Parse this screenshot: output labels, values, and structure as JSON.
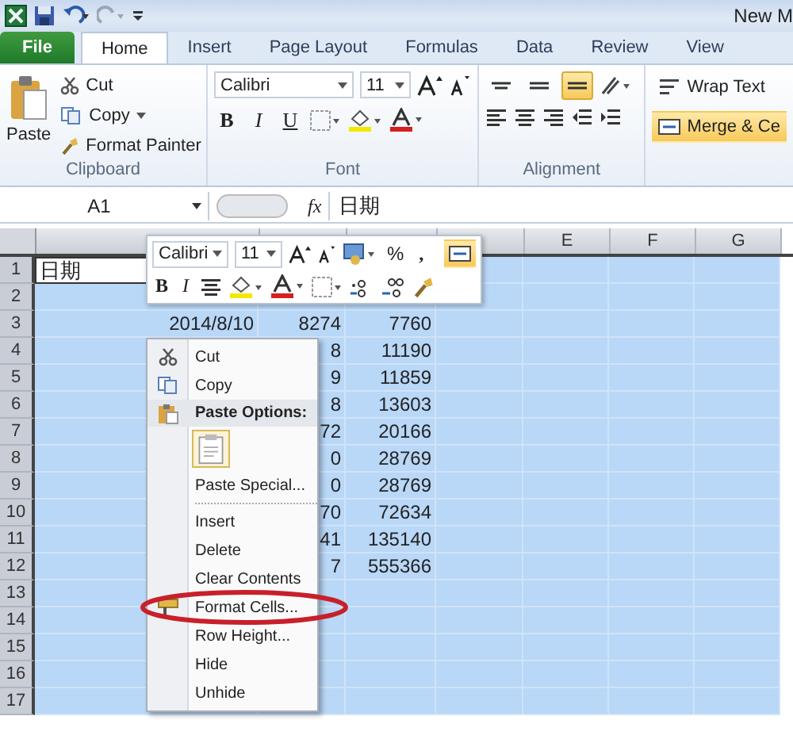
{
  "window": {
    "title": "New M"
  },
  "tabs": [
    {
      "label": "File",
      "kind": "file",
      "selected": false
    },
    {
      "label": "Home",
      "kind": "tab",
      "selected": true
    },
    {
      "label": "Insert",
      "kind": "tab",
      "selected": false
    },
    {
      "label": "Page Layout",
      "kind": "tab",
      "selected": false
    },
    {
      "label": "Formulas",
      "kind": "tab",
      "selected": false
    },
    {
      "label": "Data",
      "kind": "tab",
      "selected": false
    },
    {
      "label": "Review",
      "kind": "tab",
      "selected": false
    },
    {
      "label": "View",
      "kind": "tab",
      "selected": false
    }
  ],
  "ribbon": {
    "clipboard": {
      "label": "Clipboard",
      "paste": "Paste",
      "cut": "Cut",
      "copy": "Copy",
      "format_painter": "Format Painter"
    },
    "font": {
      "label": "Font",
      "family": "Calibri",
      "size": "11",
      "bold": "B",
      "italic": "I",
      "underline": "U"
    },
    "alignment": {
      "label": "Alignment",
      "buttons": [
        {
          "kind": "top",
          "on": false
        },
        {
          "kind": "middle",
          "on": false
        },
        {
          "kind": "bottom",
          "on": true
        }
      ],
      "wrap_text": "Wrap Text",
      "merge": {
        "label": "Merge & Ce",
        "on": true
      }
    }
  },
  "formula_bar": {
    "name_box": "A1",
    "fx": "fx",
    "value": "日期"
  },
  "grid": {
    "column_headers": [
      "E",
      "F",
      "G"
    ],
    "rows": [
      {
        "header": "1",
        "selected": true,
        "active": true,
        "cells": {
          "A": {
            "text": "日期",
            "kind": "text"
          }
        }
      },
      {
        "header": "2",
        "selected": true,
        "active": false
      },
      {
        "header": "3",
        "selected": true,
        "active": false,
        "cells": {
          "A": {
            "text": "2014/8/10",
            "kind": "number"
          },
          "B": {
            "text": "8274",
            "kind": "number"
          },
          "C": {
            "text": "7760",
            "kind": "number"
          }
        }
      },
      {
        "header": "4",
        "selected": true,
        "active": false,
        "cells": {
          "B": {
            "text": "8",
            "kind": "number"
          },
          "C": {
            "text": "11190",
            "kind": "number"
          }
        }
      },
      {
        "header": "5",
        "selected": true,
        "active": false,
        "cells": {
          "B": {
            "text": "9",
            "kind": "number"
          },
          "C": {
            "text": "11859",
            "kind": "number"
          }
        }
      },
      {
        "header": "6",
        "selected": true,
        "active": false,
        "cells": {
          "B": {
            "text": "8",
            "kind": "number"
          },
          "C": {
            "text": "13603",
            "kind": "number"
          }
        }
      },
      {
        "header": "7",
        "selected": true,
        "active": false,
        "cells": {
          "B": {
            "text": "72",
            "kind": "number"
          },
          "C": {
            "text": "20166",
            "kind": "number"
          }
        }
      },
      {
        "header": "8",
        "selected": true,
        "active": false,
        "cells": {
          "B": {
            "text": "0",
            "kind": "number"
          },
          "C": {
            "text": "28769",
            "kind": "number"
          }
        }
      },
      {
        "header": "9",
        "selected": true,
        "active": false,
        "cells": {
          "B": {
            "text": "0",
            "kind": "number"
          },
          "C": {
            "text": "28769",
            "kind": "number"
          }
        }
      },
      {
        "header": "10",
        "selected": true,
        "active": false,
        "cells": {
          "B": {
            "text": "70",
            "kind": "number"
          },
          "C": {
            "text": "72634",
            "kind": "number"
          }
        }
      },
      {
        "header": "11",
        "selected": true,
        "active": false,
        "cells": {
          "B": {
            "text": "41",
            "kind": "number"
          },
          "C": {
            "text": "135140",
            "kind": "number"
          }
        }
      },
      {
        "header": "12",
        "selected": true,
        "active": false,
        "cells": {
          "B": {
            "text": "7",
            "kind": "number"
          },
          "C": {
            "text": "555366",
            "kind": "number"
          }
        }
      },
      {
        "header": "13",
        "selected": true,
        "active": false
      },
      {
        "header": "14",
        "selected": true,
        "active": false
      },
      {
        "header": "15",
        "selected": true,
        "active": false
      },
      {
        "header": "16",
        "selected": true,
        "active": false
      },
      {
        "header": "17",
        "selected": true,
        "active": false
      }
    ]
  },
  "mini_toolbar": {
    "font": "Calibri",
    "size": "11",
    "percent": "%",
    "comma": ",",
    "bold": "B",
    "italic": "I",
    "merge": {
      "on": true
    }
  },
  "context_menu": [
    {
      "kind": "cut",
      "label": "Cut"
    },
    {
      "kind": "copy",
      "label": "Copy"
    },
    {
      "kind": "heading",
      "label": "Paste Options:"
    },
    {
      "kind": "paste-buttons"
    },
    {
      "kind": "item",
      "label": "Paste Special..."
    },
    {
      "kind": "separator"
    },
    {
      "kind": "item",
      "label": "Insert"
    },
    {
      "kind": "item",
      "label": "Delete"
    },
    {
      "kind": "item",
      "label": "Clear Contents"
    },
    {
      "kind": "format",
      "label": "Format Cells..."
    },
    {
      "kind": "item",
      "label": "Row Height..."
    },
    {
      "kind": "item",
      "label": "Hide"
    },
    {
      "kind": "item",
      "label": "Unhide"
    }
  ]
}
